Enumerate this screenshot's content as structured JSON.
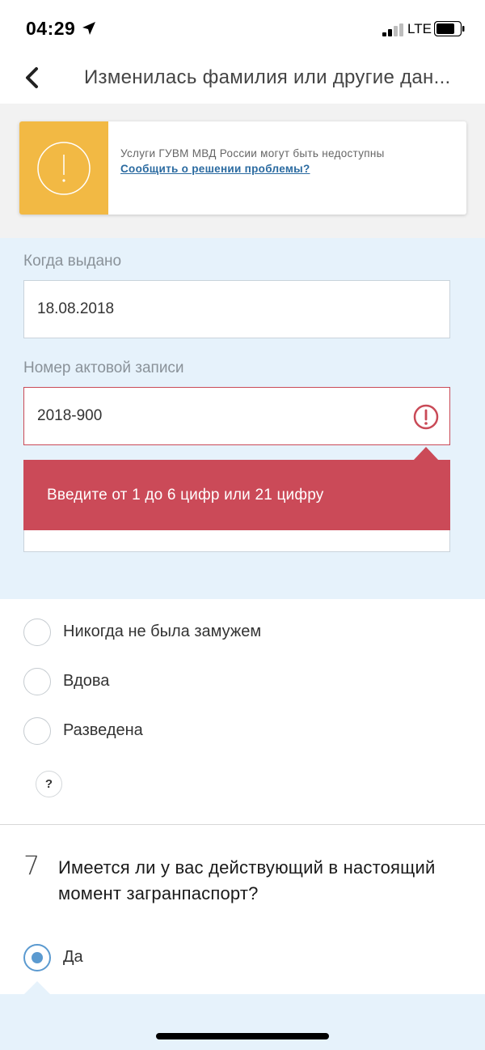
{
  "status_bar": {
    "time": "04:29",
    "network": "LTE"
  },
  "header": {
    "title": "Изменилась фамилия или другие дан..."
  },
  "alert": {
    "message": "Услуги ГУВМ МВД России могут быть недоступны",
    "link": "Сообщить о решении проблемы?"
  },
  "form": {
    "issued_date": {
      "label": "Когда выдано",
      "value": "18.08.2018"
    },
    "record_number": {
      "label": "Номер актовой записи",
      "value": "2018-900",
      "error": "Введите от 1 до 6 цифр или 21 цифру"
    }
  },
  "marital_options": [
    {
      "label": "Никогда не была замужем",
      "checked": false
    },
    {
      "label": "Вдова",
      "checked": false
    },
    {
      "label": "Разведена",
      "checked": false
    }
  ],
  "help_label": "?",
  "question7": {
    "number": "7",
    "text": "Имеется ли у вас действующий в настоящий момент загранпаспорт?",
    "option_yes": "Да"
  },
  "colors": {
    "accent": "#5b9ad0",
    "error": "#cb4a58",
    "warning": "#f2b944",
    "form_bg": "#e6f2fb"
  }
}
